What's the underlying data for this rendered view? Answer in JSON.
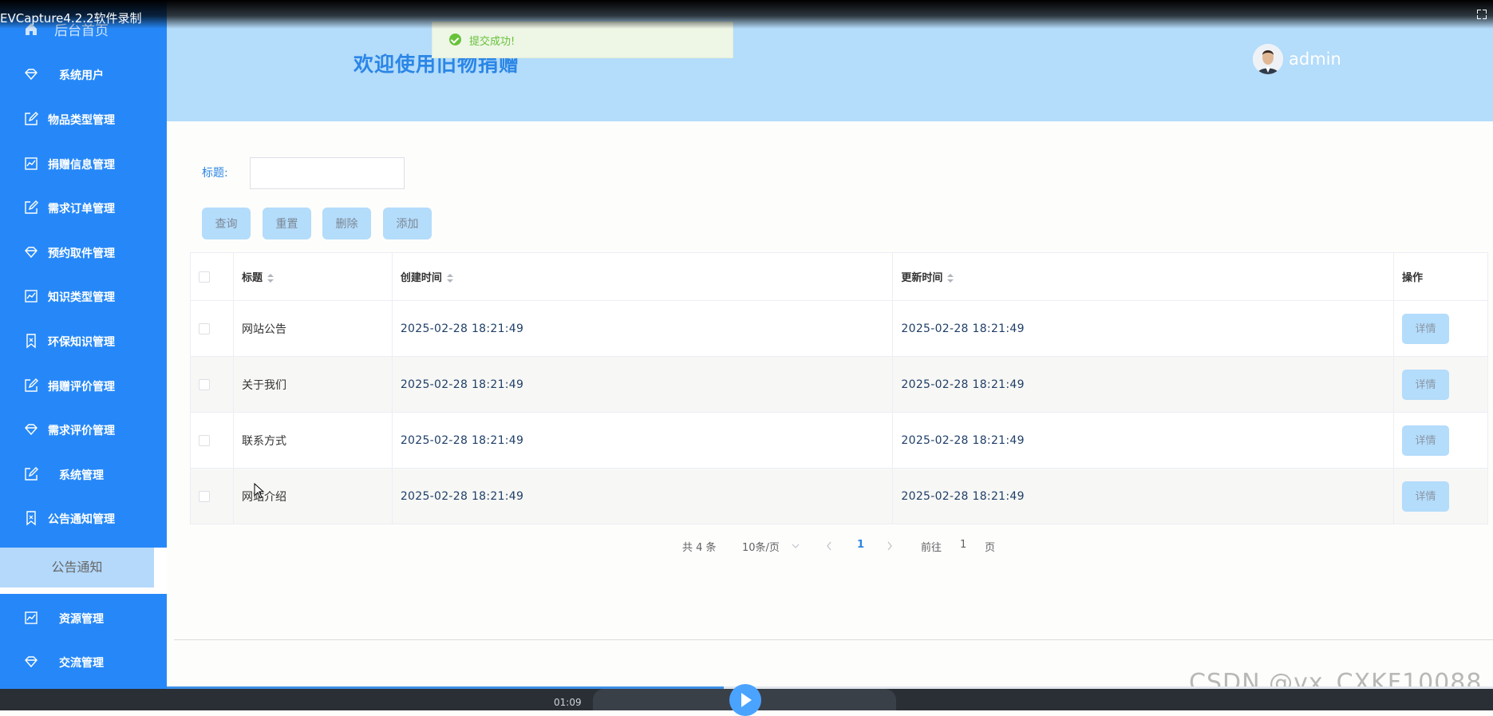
{
  "recording": {
    "title": "EVCapture4.2.2软件录制",
    "time": "01:09"
  },
  "sidebar": {
    "home": "后台首页",
    "items": [
      {
        "label": "系统用户",
        "icon": "diamond-icon"
      },
      {
        "label": "物品类型管理",
        "icon": "edit-icon"
      },
      {
        "label": "捐赠信息管理",
        "icon": "chart-icon"
      },
      {
        "label": "需求订单管理",
        "icon": "edit-icon"
      },
      {
        "label": "预约取件管理",
        "icon": "diamond-icon"
      },
      {
        "label": "知识类型管理",
        "icon": "chart-icon"
      },
      {
        "label": "环保知识管理",
        "icon": "bookmark-icon"
      },
      {
        "label": "捐赠评价管理",
        "icon": "edit-icon"
      },
      {
        "label": "需求评价管理",
        "icon": "diamond-icon"
      },
      {
        "label": "系统管理",
        "icon": "edit-icon"
      },
      {
        "label": "公告通知管理",
        "icon": "bookmark-icon"
      }
    ],
    "sub_item": "公告通知",
    "bottom_items": [
      {
        "label": "资源管理",
        "icon": "chart-icon"
      },
      {
        "label": "交流管理",
        "icon": "diamond-icon"
      }
    ]
  },
  "header": {
    "welcome": "欢迎使用旧物捐赠",
    "username": "admin"
  },
  "toast": {
    "message": "提交成功!"
  },
  "search": {
    "label": "标题:",
    "value": ""
  },
  "buttons": {
    "query": "查询",
    "reset": "重置",
    "delete": "删除",
    "add": "添加"
  },
  "table": {
    "columns": {
      "title": "标题",
      "created": "创建时间",
      "updated": "更新时间",
      "actions": "操作"
    },
    "rows": [
      {
        "title": "网站公告",
        "created": "2025-02-28 18:21:49",
        "updated": "2025-02-28 18:21:49",
        "action": "详情"
      },
      {
        "title": "关于我们",
        "created": "2025-02-28 18:21:49",
        "updated": "2025-02-28 18:21:49",
        "action": "详情"
      },
      {
        "title": "联系方式",
        "created": "2025-02-28 18:21:49",
        "updated": "2025-02-28 18:21:49",
        "action": "详情"
      },
      {
        "title": "网站介绍",
        "created": "2025-02-28 18:21:49",
        "updated": "2025-02-28 18:21:49",
        "action": "详情"
      }
    ]
  },
  "pagination": {
    "total": "共 4 条",
    "page_size": "10条/页",
    "current": "1",
    "goto_prefix": "前往",
    "goto_value": "1",
    "goto_suffix": "页"
  },
  "watermark": "CSDN @vx_CXKF10088",
  "playback": {
    "progress": 0.42
  },
  "colors": {
    "sidebar": "#2688f8",
    "header": "#b4dcfb",
    "accent": "#2b86e6",
    "success": "#67c23a"
  }
}
